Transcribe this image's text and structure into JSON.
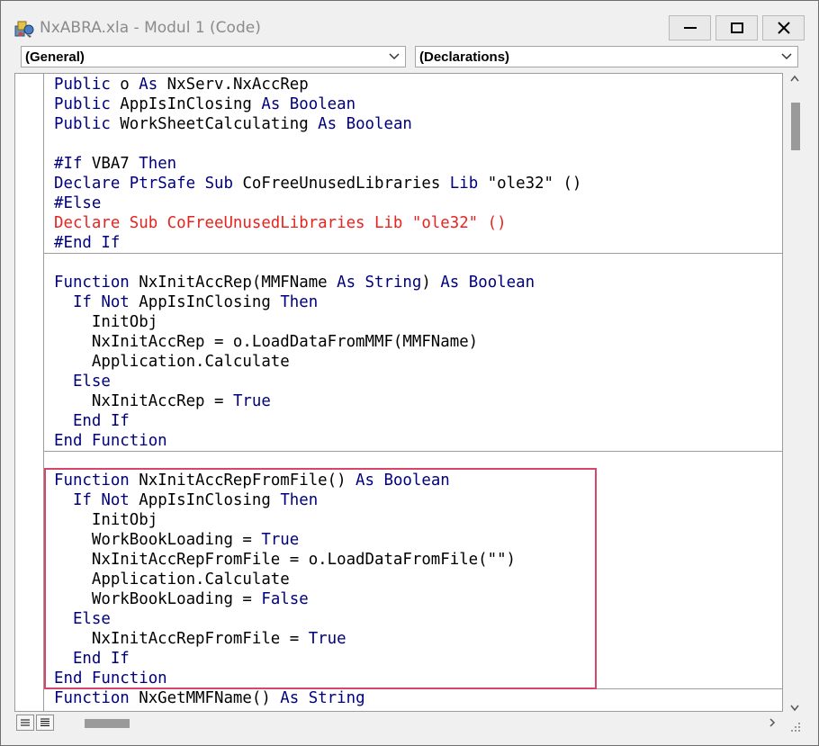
{
  "window": {
    "title": "NxABRA.xla - Modul 1 (Code)",
    "buttons": [
      "minimize",
      "restore",
      "close"
    ]
  },
  "toolbar": {
    "object_combo": "(General)",
    "procedure_combo": "(Declarations)"
  },
  "code": {
    "lines": [
      [
        [
          "kw",
          "Public"
        ],
        [
          "n",
          " o "
        ],
        [
          "kw",
          "As"
        ],
        [
          "n",
          " NxServ.NxAccRep"
        ]
      ],
      [
        [
          "kw",
          "Public"
        ],
        [
          "n",
          " AppIsInClosing "
        ],
        [
          "kw",
          "As"
        ],
        [
          "n",
          " "
        ],
        [
          "kw",
          "Boolean"
        ]
      ],
      [
        [
          "kw",
          "Public"
        ],
        [
          "n",
          " WorkSheetCalculating "
        ],
        [
          "kw",
          "As"
        ],
        [
          "n",
          " "
        ],
        [
          "kw",
          "Boolean"
        ]
      ],
      [
        [
          "n",
          " "
        ]
      ],
      [
        [
          "kw",
          "#If"
        ],
        [
          "n",
          " VBA7 "
        ],
        [
          "kw",
          "Then"
        ]
      ],
      [
        [
          "kw",
          "Declare"
        ],
        [
          "n",
          " "
        ],
        [
          "kw",
          "PtrSafe"
        ],
        [
          "n",
          " "
        ],
        [
          "kw",
          "Sub"
        ],
        [
          "n",
          " CoFreeUnusedLibraries "
        ],
        [
          "kw",
          "Lib"
        ],
        [
          "n",
          " \"ole32\" ()"
        ]
      ],
      [
        [
          "kw",
          "#Else"
        ]
      ],
      [
        [
          "red",
          "Declare Sub CoFreeUnusedLibraries Lib \"ole32\" ()"
        ]
      ],
      [
        [
          "kw",
          "#End If"
        ]
      ],
      [
        [
          "n",
          " "
        ]
      ],
      [
        [
          "kw",
          "Function"
        ],
        [
          "n",
          " NxInitAccRep(MMFName "
        ],
        [
          "kw",
          "As"
        ],
        [
          "n",
          " "
        ],
        [
          "kw",
          "String"
        ],
        [
          "n",
          ") "
        ],
        [
          "kw",
          "As"
        ],
        [
          "n",
          " "
        ],
        [
          "kw",
          "Boolean"
        ]
      ],
      [
        [
          "n",
          "  "
        ],
        [
          "kw",
          "If Not"
        ],
        [
          "n",
          " AppIsInClosing "
        ],
        [
          "kw",
          "Then"
        ]
      ],
      [
        [
          "n",
          "    InitObj"
        ]
      ],
      [
        [
          "n",
          "    NxInitAccRep = o.LoadDataFromMMF(MMFName)"
        ]
      ],
      [
        [
          "n",
          "    Application.Calculate"
        ]
      ],
      [
        [
          "n",
          "  "
        ],
        [
          "kw",
          "Else"
        ]
      ],
      [
        [
          "n",
          "    NxInitAccRep = "
        ],
        [
          "kw",
          "True"
        ]
      ],
      [
        [
          "n",
          "  "
        ],
        [
          "kw",
          "End If"
        ]
      ],
      [
        [
          "kw",
          "End Function"
        ]
      ],
      [
        [
          "n",
          " "
        ]
      ],
      [
        [
          "kw",
          "Function"
        ],
        [
          "n",
          " NxInitAccRepFromFile() "
        ],
        [
          "kw",
          "As"
        ],
        [
          "n",
          " "
        ],
        [
          "kw",
          "Boolean"
        ]
      ],
      [
        [
          "n",
          "  "
        ],
        [
          "kw",
          "If Not"
        ],
        [
          "n",
          " AppIsInClosing "
        ],
        [
          "kw",
          "Then"
        ]
      ],
      [
        [
          "n",
          "    InitObj"
        ]
      ],
      [
        [
          "n",
          "    WorkBookLoading = "
        ],
        [
          "kw",
          "True"
        ]
      ],
      [
        [
          "n",
          "    NxInitAccRepFromFile = o.LoadDataFromFile(\"\")"
        ]
      ],
      [
        [
          "n",
          "    Application.Calculate"
        ]
      ],
      [
        [
          "n",
          "    WorkBookLoading = "
        ],
        [
          "kw",
          "False"
        ]
      ],
      [
        [
          "n",
          "  "
        ],
        [
          "kw",
          "Else"
        ]
      ],
      [
        [
          "n",
          "    NxInitAccRepFromFile = "
        ],
        [
          "kw",
          "True"
        ]
      ],
      [
        [
          "n",
          "  "
        ],
        [
          "kw",
          "End If"
        ]
      ],
      [
        [
          "kw",
          "End Function"
        ]
      ],
      [
        [
          "kw",
          "Function"
        ],
        [
          "n",
          " NxGetMMFName() "
        ],
        [
          "kw",
          "As"
        ],
        [
          "n",
          " "
        ],
        [
          "kw",
          "String"
        ]
      ]
    ],
    "separators_after_line": [
      8,
      18,
      30
    ],
    "highlighted_lines": [
      20,
      30
    ],
    "highlight_color": "#d9456a",
    "keyword_color": "#00007f",
    "error_color": "#e8231f"
  },
  "view_buttons": [
    "procedure-view",
    "full-module-view"
  ]
}
